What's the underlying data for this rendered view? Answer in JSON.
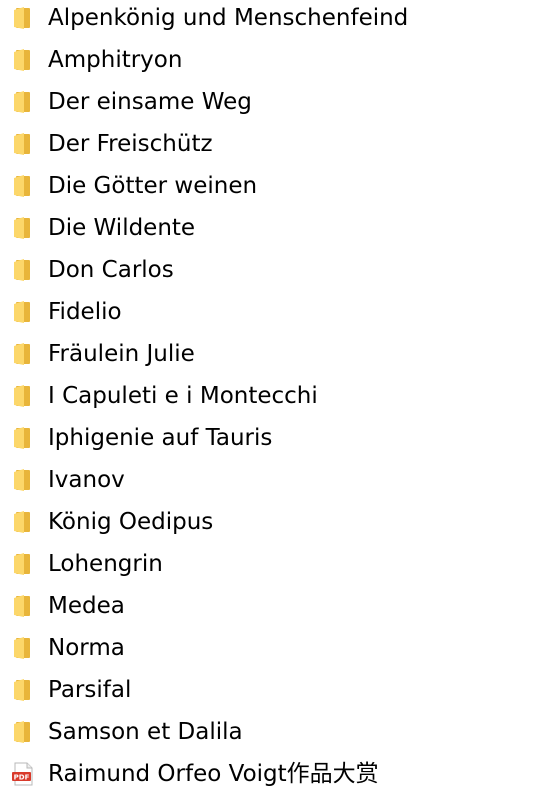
{
  "items": [
    {
      "type": "folder",
      "icon": "folder-icon",
      "label": "Alpenkönig und Menschenfeind"
    },
    {
      "type": "folder",
      "icon": "folder-icon",
      "label": "Amphitryon"
    },
    {
      "type": "folder",
      "icon": "folder-icon",
      "label": "Der einsame Weg"
    },
    {
      "type": "folder",
      "icon": "folder-icon",
      "label": "Der Freischütz"
    },
    {
      "type": "folder",
      "icon": "folder-icon",
      "label": "Die Götter weinen"
    },
    {
      "type": "folder",
      "icon": "folder-icon",
      "label": "Die Wildente"
    },
    {
      "type": "folder",
      "icon": "folder-icon",
      "label": "Don Carlos"
    },
    {
      "type": "folder",
      "icon": "folder-icon",
      "label": "Fidelio"
    },
    {
      "type": "folder",
      "icon": "folder-icon",
      "label": "Fräulein Julie"
    },
    {
      "type": "folder",
      "icon": "folder-icon",
      "label": "I Capuleti e i Montecchi"
    },
    {
      "type": "folder",
      "icon": "folder-icon",
      "label": "Iphigenie auf Tauris"
    },
    {
      "type": "folder",
      "icon": "folder-icon",
      "label": "Ivanov"
    },
    {
      "type": "folder",
      "icon": "folder-icon",
      "label": "König Oedipus"
    },
    {
      "type": "folder",
      "icon": "folder-icon",
      "label": "Lohengrin"
    },
    {
      "type": "folder",
      "icon": "folder-icon",
      "label": "Medea"
    },
    {
      "type": "folder",
      "icon": "folder-icon",
      "label": "Norma"
    },
    {
      "type": "folder",
      "icon": "folder-icon",
      "label": "Parsifal"
    },
    {
      "type": "folder",
      "icon": "folder-icon",
      "label": "Samson et Dalila"
    },
    {
      "type": "pdf",
      "icon": "pdf-file-icon",
      "icon_text": "PDF",
      "label": "Raimund Orfeo Voigt作品大赏"
    }
  ],
  "colors": {
    "folder_back": "#e8b53a",
    "folder_front": "#fcd76a",
    "pdf_badge": "#d93a2b"
  }
}
